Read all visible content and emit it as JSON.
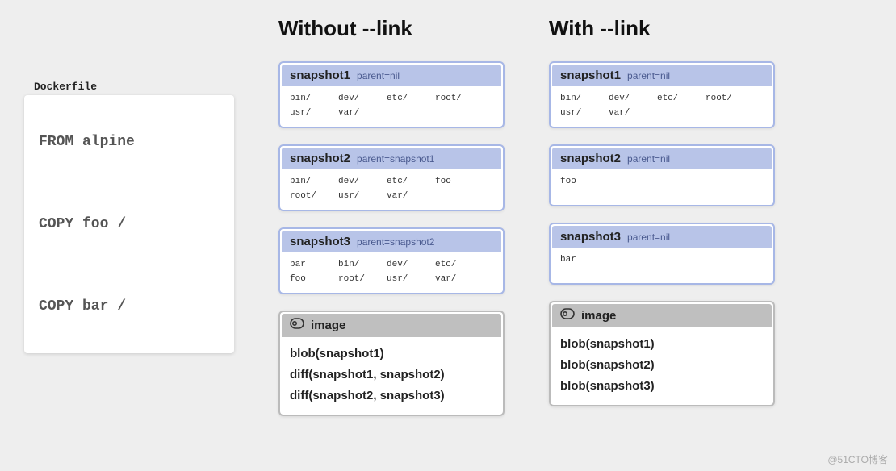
{
  "dockerfile": {
    "label": "Dockerfile",
    "lines": [
      "FROM alpine",
      "COPY foo /",
      "COPY bar /"
    ]
  },
  "without": {
    "title": "Without --link",
    "snapshots": [
      {
        "name": "snapshot1",
        "parent": "parent=nil",
        "files": [
          "bin/",
          "dev/",
          "etc/",
          "root/",
          "usr/",
          "var/"
        ]
      },
      {
        "name": "snapshot2",
        "parent": "parent=snapshot1",
        "files": [
          "bin/",
          "dev/",
          "etc/",
          "foo",
          "root/",
          "usr/",
          "var/"
        ]
      },
      {
        "name": "snapshot3",
        "parent": "parent=snapshot2",
        "files": [
          "bar",
          "bin/",
          "dev/",
          "etc/",
          "foo",
          "root/",
          "usr/",
          "var/"
        ]
      }
    ],
    "image": {
      "title": "image",
      "lines": [
        "blob(snapshot1)",
        "diff(snapshot1, snapshot2)",
        "diff(snapshot2, snapshot3)"
      ]
    }
  },
  "with": {
    "title": "With --link",
    "snapshots": [
      {
        "name": "snapshot1",
        "parent": "parent=nil",
        "files": [
          "bin/",
          "dev/",
          "etc/",
          "root/",
          "usr/",
          "var/"
        ]
      },
      {
        "name": "snapshot2",
        "parent": "parent=nil",
        "files": [
          "foo"
        ]
      },
      {
        "name": "snapshot3",
        "parent": "parent=nil",
        "files": [
          "bar"
        ]
      }
    ],
    "image": {
      "title": "image",
      "lines": [
        "blob(snapshot1)",
        "blob(snapshot2)",
        "blob(snapshot3)"
      ]
    }
  },
  "watermark": "@51CTO博客"
}
